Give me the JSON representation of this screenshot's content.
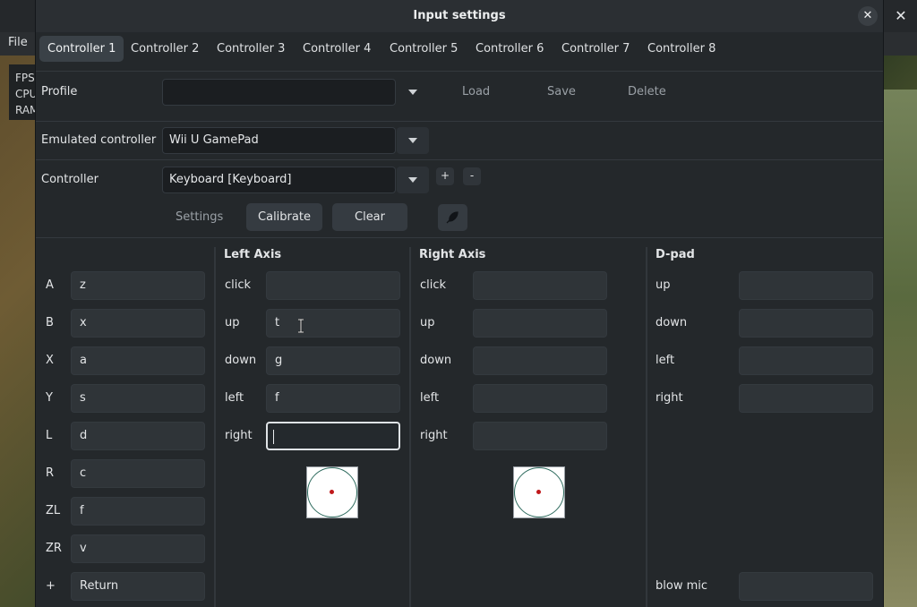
{
  "background": {
    "menu_file": "File",
    "overlay_lines": [
      "FPS",
      "CPU",
      "RAM"
    ],
    "close_glyph": "✕"
  },
  "dialog": {
    "title": "Input settings",
    "close_glyph": "✕",
    "tabs": [
      {
        "label": "Controller 1",
        "active": true
      },
      {
        "label": "Controller 2",
        "active": false
      },
      {
        "label": "Controller 3",
        "active": false
      },
      {
        "label": "Controller 4",
        "active": false
      },
      {
        "label": "Controller 5",
        "active": false
      },
      {
        "label": "Controller 6",
        "active": false
      },
      {
        "label": "Controller 7",
        "active": false
      },
      {
        "label": "Controller 8",
        "active": false
      }
    ],
    "profile": {
      "label": "Profile",
      "value": "",
      "load": "Load",
      "save": "Save",
      "delete": "Delete"
    },
    "emulated": {
      "label": "Emulated controller",
      "value": "Wii U GamePad"
    },
    "controller": {
      "label": "Controller",
      "value": "Keyboard [Keyboard]",
      "add": "+",
      "remove": "-",
      "settings": "Settings",
      "calibrate": "Calibrate",
      "clear": "Clear",
      "icon": "feather-icon"
    },
    "buttons": [
      {
        "label": "A",
        "value": "z"
      },
      {
        "label": "B",
        "value": "x"
      },
      {
        "label": "X",
        "value": "a"
      },
      {
        "label": "Y",
        "value": "s"
      },
      {
        "label": "L",
        "value": "d"
      },
      {
        "label": "R",
        "value": "c"
      },
      {
        "label": "ZL",
        "value": "f"
      },
      {
        "label": "ZR",
        "value": "v"
      },
      {
        "label": "+",
        "value": "Return"
      }
    ],
    "left_axis": {
      "title": "Left Axis",
      "rows": [
        {
          "label": "click",
          "value": ""
        },
        {
          "label": "up",
          "value": "t"
        },
        {
          "label": "down",
          "value": "g"
        },
        {
          "label": "left",
          "value": "f"
        },
        {
          "label": "right",
          "value": ""
        }
      ]
    },
    "right_axis": {
      "title": "Right Axis",
      "rows": [
        {
          "label": "click",
          "value": ""
        },
        {
          "label": "up",
          "value": ""
        },
        {
          "label": "down",
          "value": ""
        },
        {
          "label": "left",
          "value": ""
        },
        {
          "label": "right",
          "value": ""
        }
      ]
    },
    "dpad": {
      "title": "D-pad",
      "rows": [
        {
          "label": "up",
          "value": ""
        },
        {
          "label": "down",
          "value": ""
        },
        {
          "label": "left",
          "value": ""
        },
        {
          "label": "right",
          "value": ""
        }
      ],
      "blow_mic": {
        "label": "blow mic",
        "value": ""
      }
    }
  }
}
